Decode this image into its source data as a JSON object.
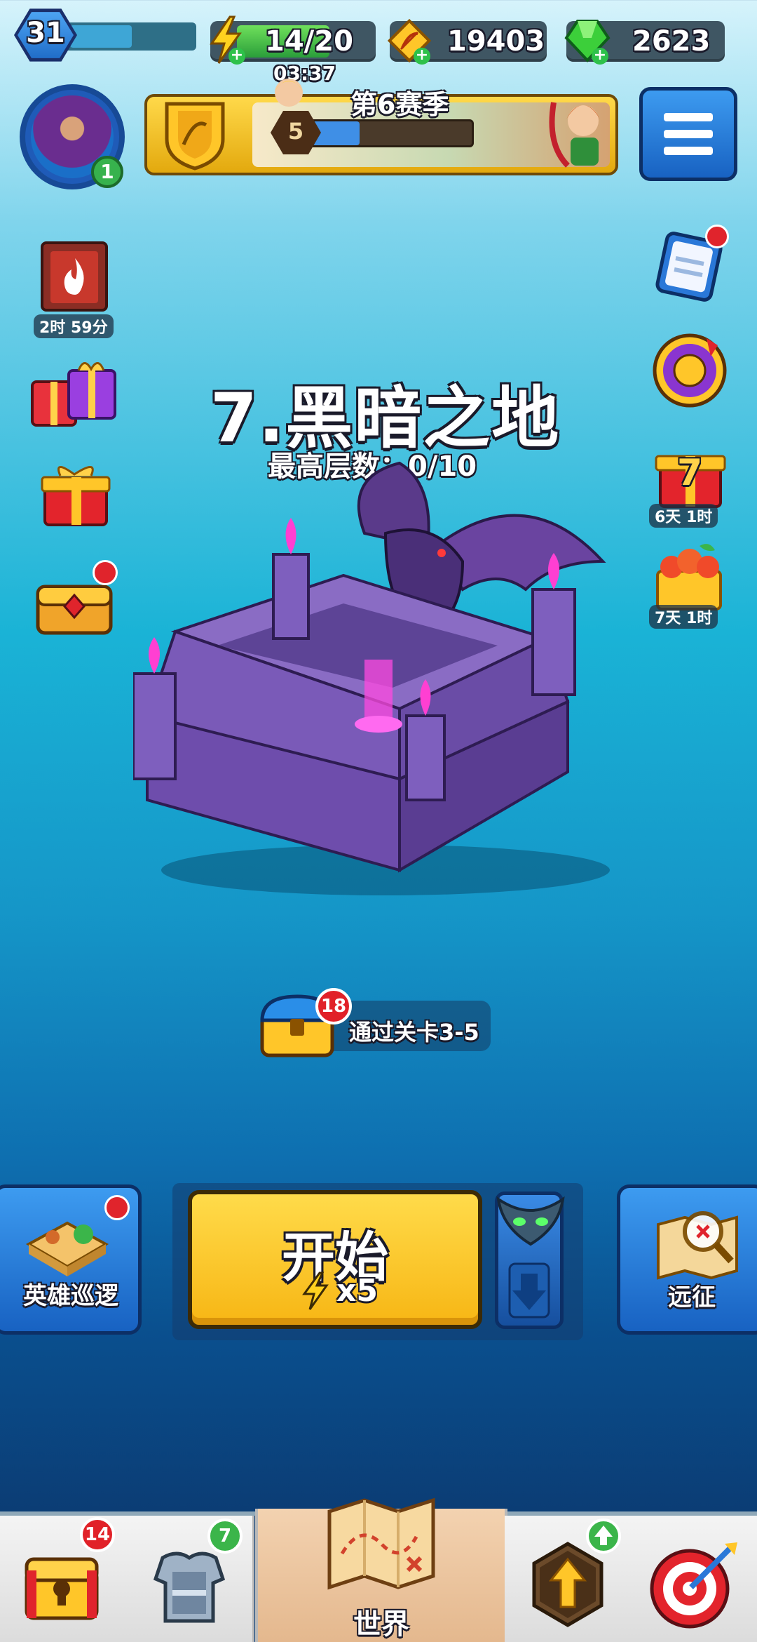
{
  "player": {
    "level": "31",
    "avatar_badge": "1"
  },
  "resources": {
    "energy": "14/20",
    "energy_timer": "03:37",
    "gold": "19403",
    "gems": "2623"
  },
  "season": {
    "title": "第6赛季",
    "rank": "5"
  },
  "left_side": {
    "book_timer": "2时 59分"
  },
  "right_side": {
    "gift_timer": "6天 1时",
    "gift_number": "7",
    "fruit_timer": "7天 1时"
  },
  "stage": {
    "title": "7.黑暗之地",
    "subtitle": "最高层数：0/10"
  },
  "chest_reward": {
    "badge": "18",
    "label": "通过关卡3-5"
  },
  "actions": {
    "patrol_label": "英雄巡逻",
    "start_label": "开始",
    "start_cost": "x5",
    "expedition_label": "远征"
  },
  "tabs": [
    {
      "badge": "14"
    },
    {
      "badge": "7"
    },
    {
      "label": "世界"
    },
    {},
    {}
  ],
  "colors": {
    "gold_button": "#ffc629",
    "blue_button": "#1f7fd8",
    "energy_green": "#39b54a",
    "badge_red": "#e12128"
  }
}
